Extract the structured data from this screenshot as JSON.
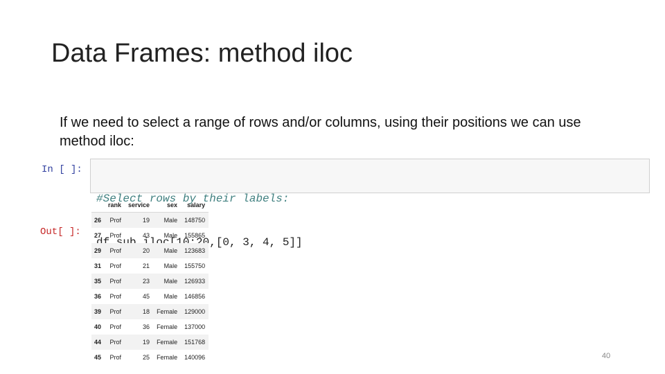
{
  "slide": {
    "title": "Data Frames: method iloc",
    "body": "If we need to select a range of rows and/or columns, using their positions we can use method iloc:",
    "page_number": "40"
  },
  "notebook": {
    "in_prompt": "In [ ]:",
    "out_prompt": "Out[ ]:",
    "code_comment": "#Select rows by their labels:",
    "code_line": "df_sub.iloc[10:20,[0, 3, 4, 5]]"
  },
  "table": {
    "columns": [
      "",
      "rank",
      "service",
      "sex",
      "salary"
    ],
    "rows": [
      [
        "26",
        "Prof",
        "19",
        "Male",
        "148750"
      ],
      [
        "27",
        "Prof",
        "43",
        "Male",
        "155865"
      ],
      [
        "29",
        "Prof",
        "20",
        "Male",
        "123683"
      ],
      [
        "31",
        "Prof",
        "21",
        "Male",
        "155750"
      ],
      [
        "35",
        "Prof",
        "23",
        "Male",
        "126933"
      ],
      [
        "36",
        "Prof",
        "45",
        "Male",
        "146856"
      ],
      [
        "39",
        "Prof",
        "18",
        "Female",
        "129000"
      ],
      [
        "40",
        "Prof",
        "36",
        "Female",
        "137000"
      ],
      [
        "44",
        "Prof",
        "19",
        "Female",
        "151768"
      ],
      [
        "45",
        "Prof",
        "25",
        "Female",
        "140096"
      ]
    ]
  }
}
